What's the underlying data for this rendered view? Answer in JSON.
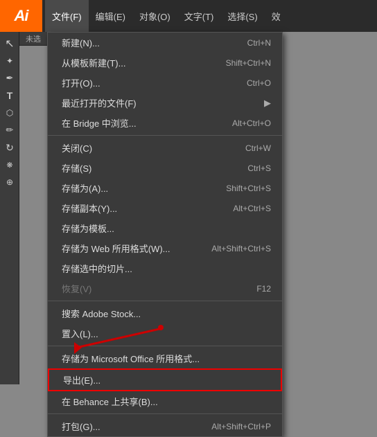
{
  "app": {
    "logo_text": "Ai"
  },
  "menu_bar": {
    "items": [
      {
        "label": "文件(F)",
        "active": true
      },
      {
        "label": "编辑(E)"
      },
      {
        "label": "对象(O)"
      },
      {
        "label": "文字(T)"
      },
      {
        "label": "选择(S)"
      },
      {
        "label": "效"
      }
    ]
  },
  "file_menu": {
    "items": [
      {
        "id": "new",
        "label": "新建(N)...",
        "shortcut": "Ctrl+N",
        "type": "item"
      },
      {
        "id": "new-from-template",
        "label": "从模板新建(T)...",
        "shortcut": "Shift+Ctrl+N",
        "type": "item"
      },
      {
        "id": "open",
        "label": "打开(O)...",
        "shortcut": "Ctrl+O",
        "type": "item"
      },
      {
        "id": "recent",
        "label": "最近打开的文件(F)",
        "shortcut": "",
        "arrow": true,
        "type": "item"
      },
      {
        "id": "bridge",
        "label": "在 Bridge 中浏览...",
        "shortcut": "Alt+Ctrl+O",
        "type": "item"
      },
      {
        "id": "sep1",
        "type": "separator"
      },
      {
        "id": "close",
        "label": "关闭(C)",
        "shortcut": "Ctrl+W",
        "type": "item"
      },
      {
        "id": "save",
        "label": "存储(S)",
        "shortcut": "Ctrl+S",
        "type": "item"
      },
      {
        "id": "save-as",
        "label": "存储为(A)...",
        "shortcut": "Shift+Ctrl+S",
        "type": "item"
      },
      {
        "id": "save-copy",
        "label": "存储副本(Y)...",
        "shortcut": "Alt+Ctrl+S",
        "type": "item"
      },
      {
        "id": "save-template",
        "label": "存储为模板...",
        "shortcut": "",
        "type": "item"
      },
      {
        "id": "save-web",
        "label": "存储为 Web 所用格式(W)...",
        "shortcut": "Alt+Shift+Ctrl+S",
        "type": "item"
      },
      {
        "id": "save-selection",
        "label": "存储选中的切片...",
        "shortcut": "",
        "type": "item"
      },
      {
        "id": "revert",
        "label": "恢复(V)",
        "shortcut": "F12",
        "type": "item",
        "dimmed": true
      },
      {
        "id": "sep2",
        "type": "separator"
      },
      {
        "id": "search-stock",
        "label": "搜索 Adobe Stock...",
        "shortcut": "",
        "type": "item"
      },
      {
        "id": "place",
        "label": "置入(L)...",
        "shortcut": "",
        "type": "item"
      },
      {
        "id": "sep3",
        "type": "separator"
      },
      {
        "id": "save-ms-office",
        "label": "存储为 Microsoft Office 所用格式...",
        "shortcut": "",
        "type": "item"
      },
      {
        "id": "export",
        "label": "导出(E)...",
        "shortcut": "",
        "type": "item",
        "highlighted": true
      },
      {
        "id": "behance",
        "label": "在 Behance 上共享(B)...",
        "shortcut": "",
        "type": "item"
      },
      {
        "id": "sep4",
        "type": "separator"
      },
      {
        "id": "package",
        "label": "打包(G)...",
        "shortcut": "Alt+Shift+Ctrl+P",
        "type": "item"
      }
    ]
  },
  "toolbar": {
    "tools": [
      {
        "name": "selection",
        "icon": "↖"
      },
      {
        "name": "direct-selection",
        "icon": "✦"
      },
      {
        "name": "pen",
        "icon": "✒"
      },
      {
        "name": "type",
        "icon": "T"
      },
      {
        "name": "shape",
        "icon": "⬡"
      },
      {
        "name": "pencil",
        "icon": "✏"
      },
      {
        "name": "rotate",
        "icon": "↻"
      },
      {
        "name": "transform",
        "icon": "❋"
      },
      {
        "name": "eyedropper",
        "icon": "⊕"
      }
    ]
  }
}
